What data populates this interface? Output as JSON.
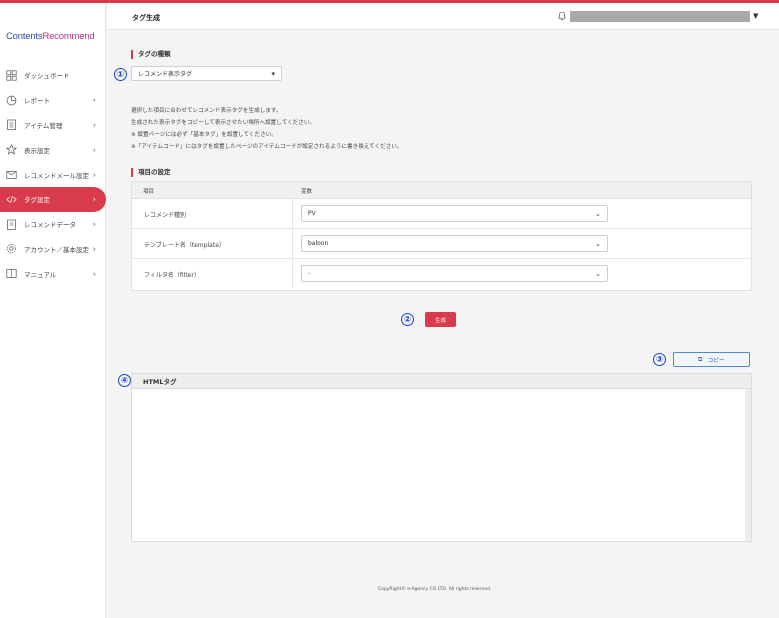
{
  "app": {
    "logo_part1": "Contents",
    "logo_part2": "Recommend",
    "accent_color": "#d83b4c"
  },
  "header": {
    "title": "タグ生成",
    "account_name": ""
  },
  "sidebar": {
    "items": [
      {
        "label": "ダッシュボード",
        "icon": "dashboard-icon",
        "chevron": false,
        "active": false
      },
      {
        "label": "レポート",
        "icon": "report-icon",
        "chevron": true,
        "active": false
      },
      {
        "label": "アイテム管理",
        "icon": "item-icon",
        "chevron": true,
        "active": false
      },
      {
        "label": "表示設定",
        "icon": "star-icon",
        "chevron": true,
        "active": false
      },
      {
        "label": "レコメンドメール設定",
        "icon": "mail-icon",
        "chevron": true,
        "active": false
      },
      {
        "label": "タグ設定",
        "icon": "code-icon",
        "chevron": true,
        "active": true
      },
      {
        "label": "レコメンドデータ",
        "icon": "data-icon",
        "chevron": true,
        "active": false
      },
      {
        "label": "アカウント／基本設定",
        "icon": "gear-icon",
        "chevron": true,
        "active": false
      },
      {
        "label": "マニュアル",
        "icon": "book-icon",
        "chevron": true,
        "active": false
      }
    ]
  },
  "tag_type": {
    "section_title": "タグの種類",
    "selected": "レコメンド表示タグ",
    "marker": "①"
  },
  "description": {
    "lines": [
      "選択した項目に合わせてレコメンド表示タグを生成します。",
      "生成された表示タグをコピーして表示させたい場所へ設置してください。",
      "※ 設置ページには必ず「基本タグ」を設置してください。",
      "※「アイテムコード」にはタグを設置したページのアイテムコードが設定されるように書き換えてください。"
    ]
  },
  "settings": {
    "section_title": "項目の設定",
    "col_item": "項目",
    "col_value": "変数",
    "rows": [
      {
        "label": "レコメンド種別",
        "value": "PV"
      },
      {
        "label": "テンプレート名（template）",
        "value": "baloon"
      },
      {
        "label": "フィルタ名（filter）",
        "value": "-"
      }
    ]
  },
  "generate": {
    "label": "生成",
    "marker": "②"
  },
  "copy": {
    "label": "コピー",
    "marker": "③"
  },
  "html_tag": {
    "title": "HTMLタグ",
    "marker": "④",
    "content": ""
  },
  "footer": {
    "text": "CopyRight© e-Agency CO LTD. All rights reserved."
  }
}
